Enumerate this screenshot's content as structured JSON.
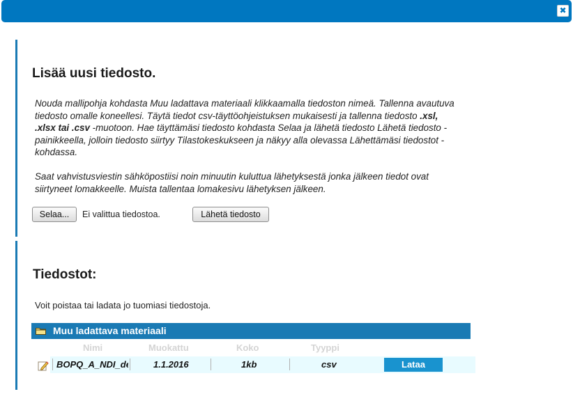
{
  "dialog": {
    "close_label": "✖"
  },
  "upload": {
    "title": "Lisää uusi tiedosto.",
    "para1_a": "Nouda mallipohja kohdasta Muu ladattava materiaali klikkaamalla tiedoston nimeä. Tallenna avautuva tiedosto omalle koneellesi. Täytä tiedot csv-täyttöohjeistuksen mukaisesti ja tallenna tiedosto ",
    "para1_formats": ".xsl, .xlsx tai .csv",
    "para1_b": " -muotoon. Hae täyttämäsi tiedosto kohdasta Selaa ja lähetä tiedosto Lähetä tiedosto -painikkeella, jolloin tiedosto siirtyy Tilastokeskukseen ja näkyy alla olevassa Lähettämäsi tiedostot -kohdassa.",
    "para2": "Saat vahvistusviestin sähköpostiisi noin minuutin kuluttua lähetyksestä jonka jälkeen tiedot ovat siirtyneet lomakkeelle. Muista tallentaa lomakesivu lähetyksen jälkeen.",
    "browse_label": "Selaa...",
    "no_file_text": "Ei valittua tiedostoa.",
    "send_label": "Lähetä tiedosto"
  },
  "files": {
    "title": "Tiedostot:",
    "intro": "Voit poistaa tai ladata jo tuomiasi tiedostoja.",
    "folder_label": "Muu ladattava materiaali",
    "columns": {
      "name": "Nimi",
      "modified": "Muokattu",
      "size": "Koko",
      "type": "Tyyppi"
    },
    "rows": [
      {
        "name": "BOPQ_A_NDI_de",
        "modified": "1.1.2016",
        "size": "1kb",
        "type": "csv",
        "action": "Lataa"
      }
    ]
  },
  "colors": {
    "accent": "#1a7ab4",
    "titlebar": "#0077c0",
    "download_button": "#1993cf",
    "row_bg": "#e8fbff"
  },
  "icons": {
    "close": "close-icon",
    "folder": "folder-icon",
    "edit": "pencil-icon"
  }
}
